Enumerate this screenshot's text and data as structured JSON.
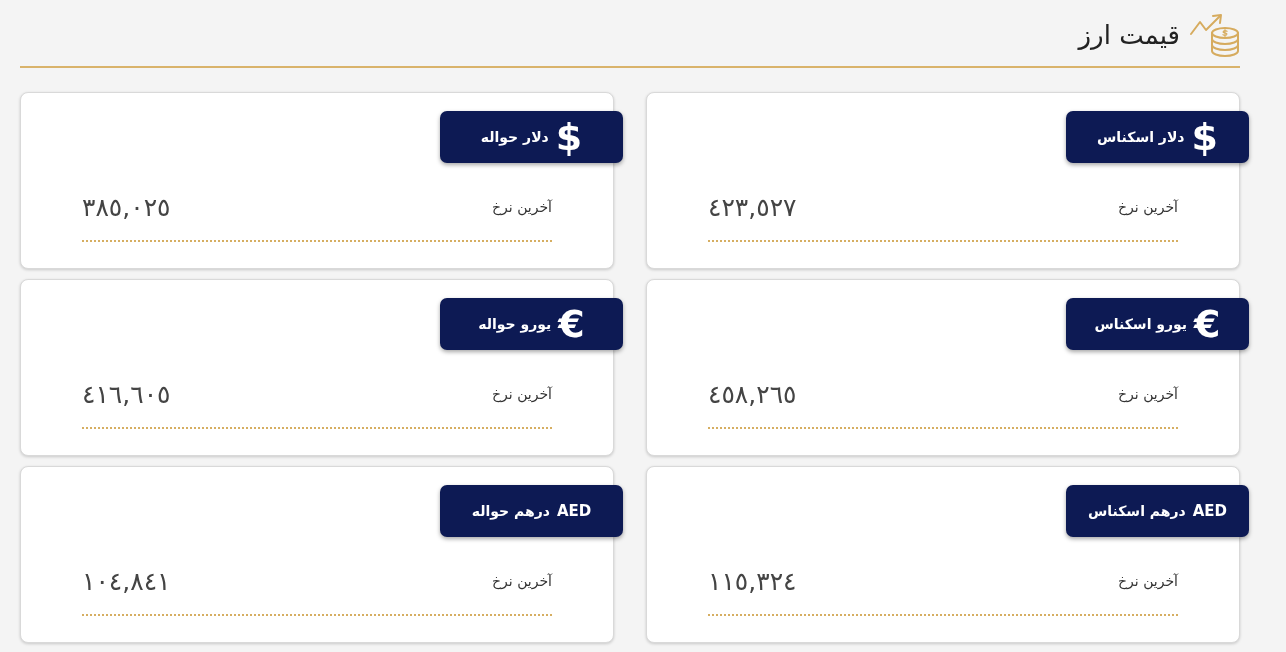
{
  "header": {
    "title": "قیمت ارز"
  },
  "cards": [
    {
      "symbol": {
        "kind": "glyph",
        "text": "$"
      },
      "name": "دلار اسکناس",
      "label": "آخرین نرخ",
      "value": "٤٢٣,٥٢٧"
    },
    {
      "symbol": {
        "kind": "glyph",
        "text": "$"
      },
      "name": "دلار حواله",
      "label": "آخرین نرخ",
      "value": "٣٨٥,٠٢٥"
    },
    {
      "symbol": {
        "kind": "glyph",
        "text": "€"
      },
      "name": "یورو اسکناس",
      "label": "آخرین نرخ",
      "value": "٤٥٨,٢٦٥"
    },
    {
      "symbol": {
        "kind": "glyph",
        "text": "€"
      },
      "name": "یورو حواله",
      "label": "آخرین نرخ",
      "value": "٤١٦,٦٠٥"
    },
    {
      "symbol": {
        "kind": "code",
        "text": "AED"
      },
      "name": "درهم اسکناس",
      "label": "آخرین نرخ",
      "value": "١١٥,٣٢٤"
    },
    {
      "symbol": {
        "kind": "code",
        "text": "AED"
      },
      "name": "درهم حواله",
      "label": "آخرین نرخ",
      "value": "١٠٤,٨٤١"
    }
  ]
}
